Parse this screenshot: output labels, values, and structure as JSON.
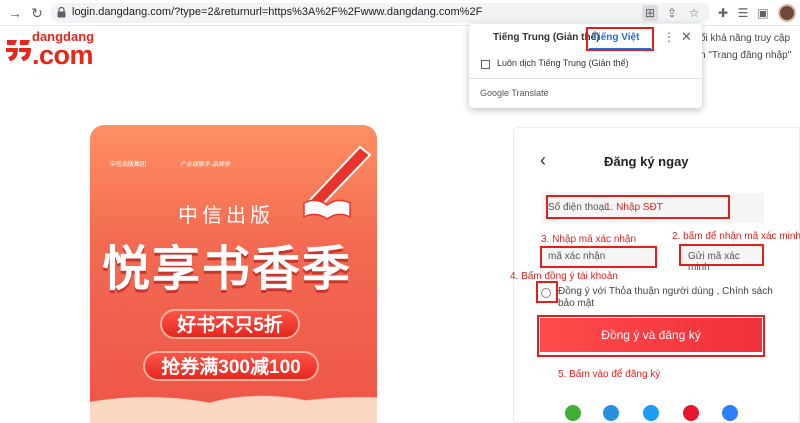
{
  "browser": {
    "url": "login.dangdang.com/?type=2&returnurl=https%3A%2F%2Fwww.dangdang.com%2F"
  },
  "logo": {
    "name": "dangdang",
    "suffix": ".com"
  },
  "background_note": {
    "line1": "ối khả năng truy cập",
    "line2": "n \"Trang đăng nhập\""
  },
  "translate_popup": {
    "tab_source": "Tiếng Trung (Giản thể)",
    "tab_target": "Tiếng Việt",
    "always_translate": "Luôn dịch Tiếng Trung (Giản thể)",
    "brand_google": "Google",
    "brand_translate": "Translate"
  },
  "banner": {
    "publisher": "中信出版集团",
    "campaign": "产业链联手·品牌季",
    "subtitle": "中信出版",
    "title": "悦享书香季",
    "pill1": "好书不只5折",
    "pill2": "抢券满300减100"
  },
  "form": {
    "title": "Đăng ký ngay",
    "phone_placeholder": "Số điện thoại",
    "code_placeholder": "mã xác nhận",
    "get_code": "Gửi mã xác minh",
    "agree_text": "Đồng ý với Thỏa thuận người dùng , Chính sách bảo mật",
    "submit": "Đồng ý và đăng ký"
  },
  "annotations": {
    "step1": "1. Nhập SĐT",
    "step2": "2. bấm để nhận mã xác minh",
    "step3": "3. Nhập mã xác nhận",
    "step4": "4. Bấm đồng ý tài khoản",
    "step5": "5. Bấm vào để đăng ký"
  },
  "colors": {
    "accent": "#e0201d",
    "brand": "#e5271b",
    "link": "#1a73e8"
  }
}
